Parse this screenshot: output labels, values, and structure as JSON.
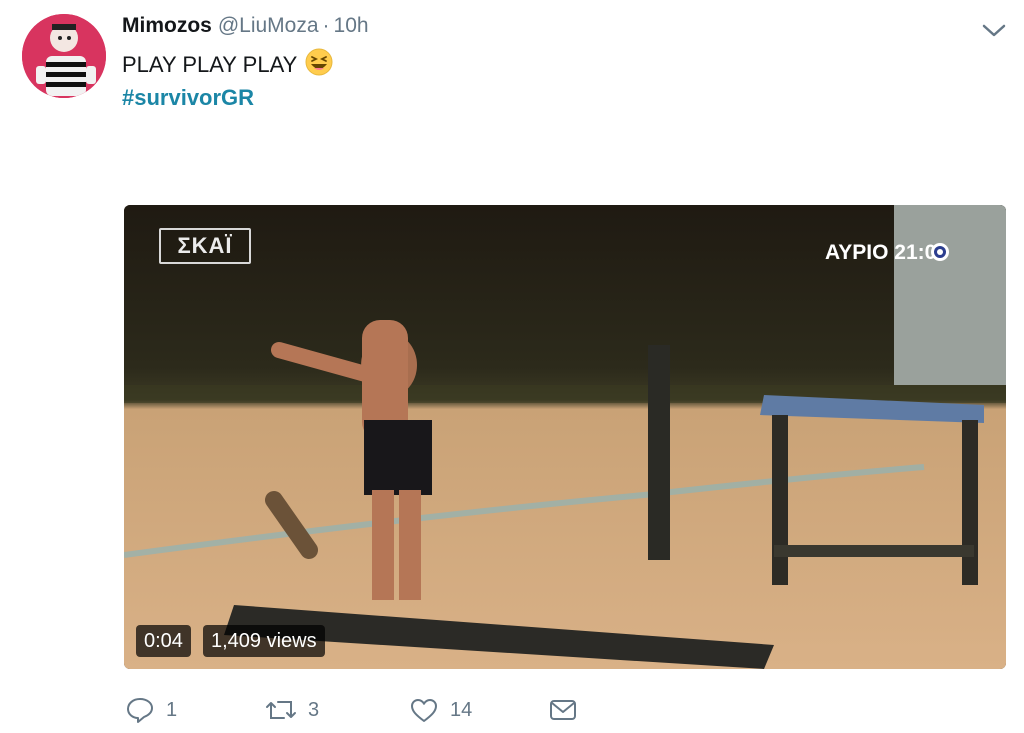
{
  "tweet": {
    "display_name": "Mimozos",
    "handle": "@LiuMoza",
    "separator": "·",
    "time": "10h",
    "text": "PLAY PLAY PLAY",
    "emoji": "😆",
    "hashtag": "#survivorGR"
  },
  "media": {
    "channel_logo": "ΣΚΑΪ",
    "airing_label": "ΑΥΡΙΟ 21:00",
    "duration": "0:04",
    "views": "1,409 views"
  },
  "actions": {
    "reply_count": "1",
    "retweet_count": "3",
    "like_count": "14"
  },
  "icons": {
    "reply": "reply-icon",
    "retweet": "retweet-icon",
    "like": "heart-icon",
    "message": "envelope-icon",
    "caret": "chevron-down-icon"
  },
  "colors": {
    "hashtag": "#1b86a6",
    "meta_text": "#657786",
    "avatar_bg": "#d8345f"
  }
}
